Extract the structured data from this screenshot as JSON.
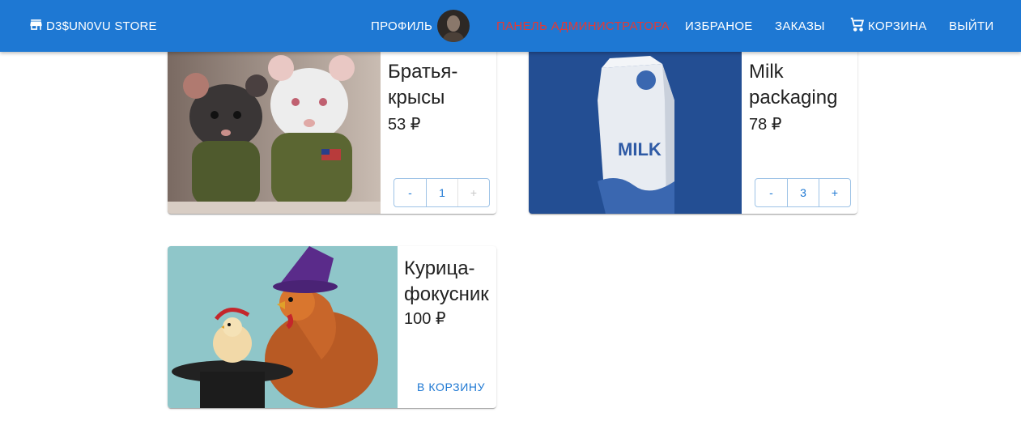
{
  "header": {
    "brand": "D3$UN0VU STORE",
    "profile": "ПРОФИЛЬ",
    "admin_panel": "ПАНЕЛЬ АДМИНИСТРАТОРА",
    "favorites": "ИЗБРАНОЕ",
    "orders": "ЗАКАЗЫ",
    "cart": "КОРЗИНА",
    "logout": "ВЫЙТИ",
    "colors": {
      "bar": "#1e78d3",
      "admin_link": "#e53935"
    }
  },
  "products": [
    {
      "title": "Братья-крысы",
      "price": "53 ₽",
      "qty": "1",
      "minus": "-",
      "plus": "+",
      "image": "rats-image"
    },
    {
      "title": "Milk packaging",
      "price": "78 ₽",
      "qty": "3",
      "minus": "-",
      "plus": "+",
      "image": "milk-image",
      "milk_text": "MILK"
    },
    {
      "title": "Курица-фокусник",
      "price": "100 ₽",
      "add_to_cart": "В КОРЗИНУ",
      "image": "chicken-image"
    }
  ]
}
